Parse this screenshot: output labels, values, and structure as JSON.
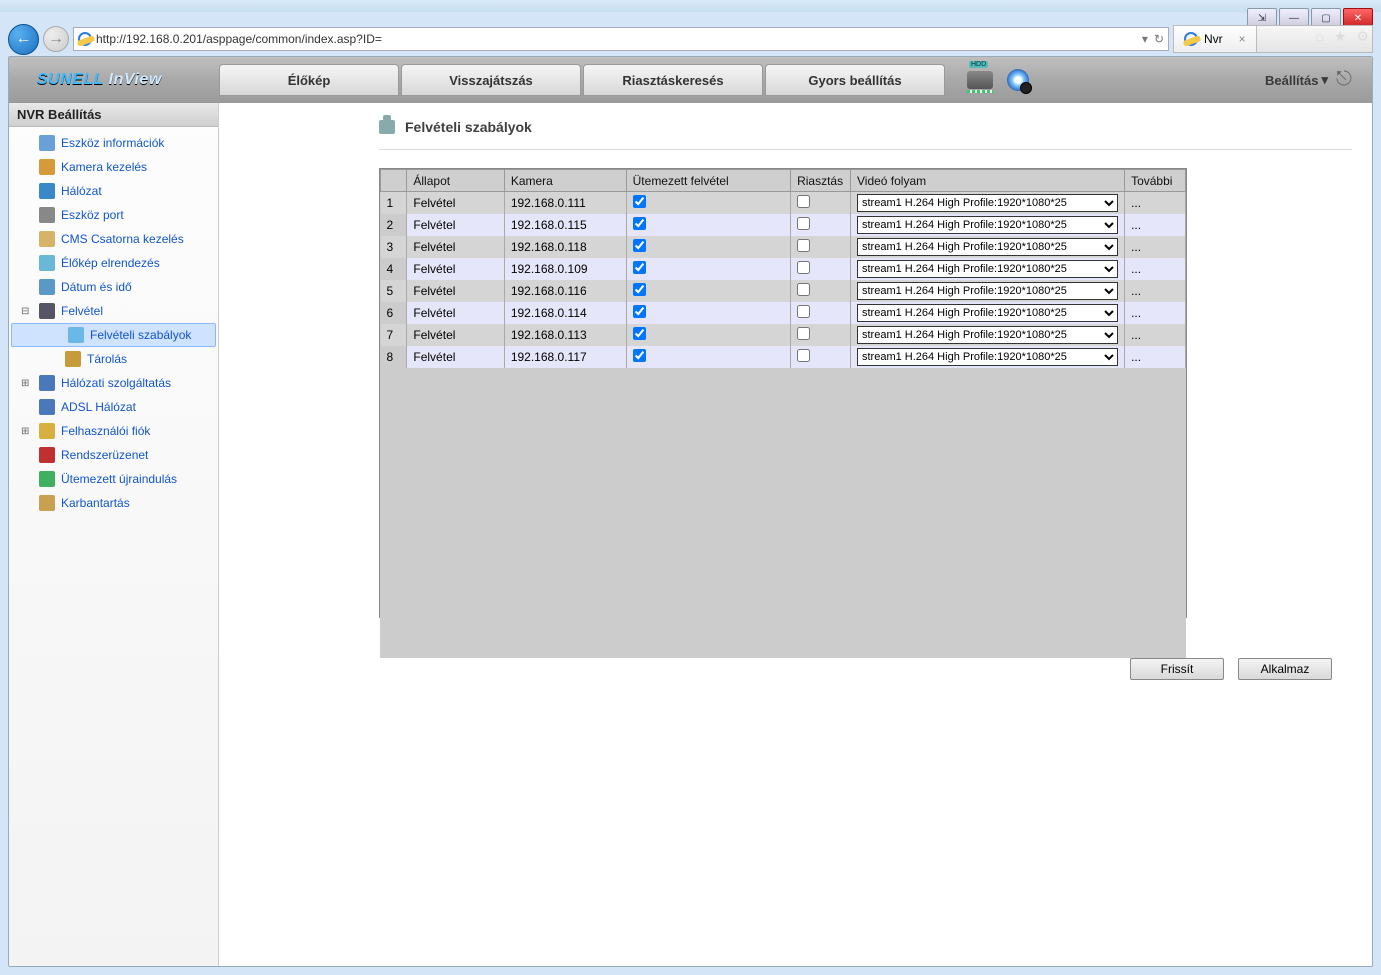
{
  "window": {
    "url": "http://192.168.0.201/asppage/common/index.asp?ID=",
    "tab_title": "Nvr"
  },
  "brand": "SUNELL InView",
  "nav_tabs": [
    "Élőkép",
    "Visszajátszás",
    "Riasztáskeresés",
    "Gyors beállítás"
  ],
  "settings_label": "Beállítás",
  "sidebar_header": "NVR Beállítás",
  "sidebar": [
    {
      "label": "Eszköz információk",
      "icon": "#6aa0d8"
    },
    {
      "label": "Kamera kezelés",
      "icon": "#d79a3a"
    },
    {
      "label": "Hálózat",
      "icon": "#3a88c8"
    },
    {
      "label": "Eszköz port",
      "icon": "#888"
    },
    {
      "label": "CMS Csatorna kezelés",
      "icon": "#d7b36a"
    },
    {
      "label": "Élőkép elrendezés",
      "icon": "#6ab8d8"
    },
    {
      "label": "Dátum és idő",
      "icon": "#5a98c8"
    },
    {
      "label": "Felvétel",
      "icon": "#556",
      "expandable": true,
      "children": [
        {
          "label": "Felvételi szabályok",
          "icon": "#6ab8e8",
          "selected": true
        },
        {
          "label": "Tárolás",
          "icon": "#c79a3a"
        }
      ]
    },
    {
      "label": "Hálózati szolgáltatás",
      "icon": "#4a78b8",
      "expandable": true,
      "collapsed": true
    },
    {
      "label": "ADSL Hálózat",
      "icon": "#4a78b8"
    },
    {
      "label": "Felhasználói fiók",
      "icon": "#d8b040",
      "expandable": true,
      "collapsed": true
    },
    {
      "label": "Rendszerüzenet",
      "icon": "#c03030"
    },
    {
      "label": "Ütemezett újraindulás",
      "icon": "#40b060"
    },
    {
      "label": "Karbantartás",
      "icon": "#c7a050"
    }
  ],
  "page_title": "Felvételi szabályok",
  "table": {
    "headers": [
      "",
      "Állapot",
      "Kamera",
      "Ütemezett felvétel",
      "Riasztás",
      "Videó folyam",
      "További"
    ],
    "rows": [
      {
        "n": 1,
        "status": "Felvétel",
        "camera": "192.168.0.111",
        "sched": true,
        "alarm": false,
        "stream": "stream1 H.264 High Profile:1920*1080*25",
        "more": "..."
      },
      {
        "n": 2,
        "status": "Felvétel",
        "camera": "192.168.0.115",
        "sched": true,
        "alarm": false,
        "stream": "stream1 H.264 High Profile:1920*1080*25",
        "more": "..."
      },
      {
        "n": 3,
        "status": "Felvétel",
        "camera": "192.168.0.118",
        "sched": true,
        "alarm": false,
        "stream": "stream1 H.264 High Profile:1920*1080*25",
        "more": "..."
      },
      {
        "n": 4,
        "status": "Felvétel",
        "camera": "192.168.0.109",
        "sched": true,
        "alarm": false,
        "stream": "stream1 H.264 High Profile:1920*1080*25",
        "more": "..."
      },
      {
        "n": 5,
        "status": "Felvétel",
        "camera": "192.168.0.116",
        "sched": true,
        "alarm": false,
        "stream": "stream1 H.264 High Profile:1920*1080*25",
        "more": "..."
      },
      {
        "n": 6,
        "status": "Felvétel",
        "camera": "192.168.0.114",
        "sched": true,
        "alarm": false,
        "stream": "stream1 H.264 High Profile:1920*1080*25",
        "more": "..."
      },
      {
        "n": 7,
        "status": "Felvétel",
        "camera": "192.168.0.113",
        "sched": true,
        "alarm": false,
        "stream": "stream1 H.264 High Profile:1920*1080*25",
        "more": "..."
      },
      {
        "n": 8,
        "status": "Felvétel",
        "camera": "192.168.0.117",
        "sched": true,
        "alarm": false,
        "stream": "stream1 H.264 High Profile:1920*1080*25",
        "more": "..."
      }
    ]
  },
  "buttons": {
    "refresh": "Frissít",
    "apply": "Alkalmaz"
  }
}
